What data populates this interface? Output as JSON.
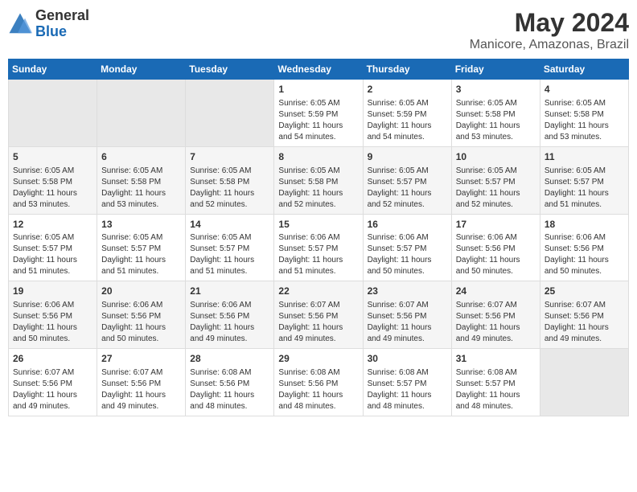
{
  "logo": {
    "general": "General",
    "blue": "Blue"
  },
  "title": {
    "month_year": "May 2024",
    "location": "Manicore, Amazonas, Brazil"
  },
  "weekdays": [
    "Sunday",
    "Monday",
    "Tuesday",
    "Wednesday",
    "Thursday",
    "Friday",
    "Saturday"
  ],
  "weeks": [
    [
      {
        "day": "",
        "info": ""
      },
      {
        "day": "",
        "info": ""
      },
      {
        "day": "",
        "info": ""
      },
      {
        "day": "1",
        "info": "Sunrise: 6:05 AM\nSunset: 5:59 PM\nDaylight: 11 hours\nand 54 minutes."
      },
      {
        "day": "2",
        "info": "Sunrise: 6:05 AM\nSunset: 5:59 PM\nDaylight: 11 hours\nand 54 minutes."
      },
      {
        "day": "3",
        "info": "Sunrise: 6:05 AM\nSunset: 5:58 PM\nDaylight: 11 hours\nand 53 minutes."
      },
      {
        "day": "4",
        "info": "Sunrise: 6:05 AM\nSunset: 5:58 PM\nDaylight: 11 hours\nand 53 minutes."
      }
    ],
    [
      {
        "day": "5",
        "info": "Sunrise: 6:05 AM\nSunset: 5:58 PM\nDaylight: 11 hours\nand 53 minutes."
      },
      {
        "day": "6",
        "info": "Sunrise: 6:05 AM\nSunset: 5:58 PM\nDaylight: 11 hours\nand 53 minutes."
      },
      {
        "day": "7",
        "info": "Sunrise: 6:05 AM\nSunset: 5:58 PM\nDaylight: 11 hours\nand 52 minutes."
      },
      {
        "day": "8",
        "info": "Sunrise: 6:05 AM\nSunset: 5:58 PM\nDaylight: 11 hours\nand 52 minutes."
      },
      {
        "day": "9",
        "info": "Sunrise: 6:05 AM\nSunset: 5:57 PM\nDaylight: 11 hours\nand 52 minutes."
      },
      {
        "day": "10",
        "info": "Sunrise: 6:05 AM\nSunset: 5:57 PM\nDaylight: 11 hours\nand 52 minutes."
      },
      {
        "day": "11",
        "info": "Sunrise: 6:05 AM\nSunset: 5:57 PM\nDaylight: 11 hours\nand 51 minutes."
      }
    ],
    [
      {
        "day": "12",
        "info": "Sunrise: 6:05 AM\nSunset: 5:57 PM\nDaylight: 11 hours\nand 51 minutes."
      },
      {
        "day": "13",
        "info": "Sunrise: 6:05 AM\nSunset: 5:57 PM\nDaylight: 11 hours\nand 51 minutes."
      },
      {
        "day": "14",
        "info": "Sunrise: 6:05 AM\nSunset: 5:57 PM\nDaylight: 11 hours\nand 51 minutes."
      },
      {
        "day": "15",
        "info": "Sunrise: 6:06 AM\nSunset: 5:57 PM\nDaylight: 11 hours\nand 51 minutes."
      },
      {
        "day": "16",
        "info": "Sunrise: 6:06 AM\nSunset: 5:57 PM\nDaylight: 11 hours\nand 50 minutes."
      },
      {
        "day": "17",
        "info": "Sunrise: 6:06 AM\nSunset: 5:56 PM\nDaylight: 11 hours\nand 50 minutes."
      },
      {
        "day": "18",
        "info": "Sunrise: 6:06 AM\nSunset: 5:56 PM\nDaylight: 11 hours\nand 50 minutes."
      }
    ],
    [
      {
        "day": "19",
        "info": "Sunrise: 6:06 AM\nSunset: 5:56 PM\nDaylight: 11 hours\nand 50 minutes."
      },
      {
        "day": "20",
        "info": "Sunrise: 6:06 AM\nSunset: 5:56 PM\nDaylight: 11 hours\nand 50 minutes."
      },
      {
        "day": "21",
        "info": "Sunrise: 6:06 AM\nSunset: 5:56 PM\nDaylight: 11 hours\nand 49 minutes."
      },
      {
        "day": "22",
        "info": "Sunrise: 6:07 AM\nSunset: 5:56 PM\nDaylight: 11 hours\nand 49 minutes."
      },
      {
        "day": "23",
        "info": "Sunrise: 6:07 AM\nSunset: 5:56 PM\nDaylight: 11 hours\nand 49 minutes."
      },
      {
        "day": "24",
        "info": "Sunrise: 6:07 AM\nSunset: 5:56 PM\nDaylight: 11 hours\nand 49 minutes."
      },
      {
        "day": "25",
        "info": "Sunrise: 6:07 AM\nSunset: 5:56 PM\nDaylight: 11 hours\nand 49 minutes."
      }
    ],
    [
      {
        "day": "26",
        "info": "Sunrise: 6:07 AM\nSunset: 5:56 PM\nDaylight: 11 hours\nand 49 minutes."
      },
      {
        "day": "27",
        "info": "Sunrise: 6:07 AM\nSunset: 5:56 PM\nDaylight: 11 hours\nand 49 minutes."
      },
      {
        "day": "28",
        "info": "Sunrise: 6:08 AM\nSunset: 5:56 PM\nDaylight: 11 hours\nand 48 minutes."
      },
      {
        "day": "29",
        "info": "Sunrise: 6:08 AM\nSunset: 5:56 PM\nDaylight: 11 hours\nand 48 minutes."
      },
      {
        "day": "30",
        "info": "Sunrise: 6:08 AM\nSunset: 5:57 PM\nDaylight: 11 hours\nand 48 minutes."
      },
      {
        "day": "31",
        "info": "Sunrise: 6:08 AM\nSunset: 5:57 PM\nDaylight: 11 hours\nand 48 minutes."
      },
      {
        "day": "",
        "info": ""
      }
    ]
  ]
}
